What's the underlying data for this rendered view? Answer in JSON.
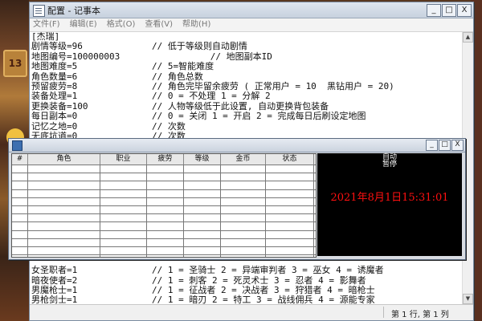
{
  "background": {
    "sign_text": "13"
  },
  "notepad": {
    "title": "配置 - 记事本",
    "caption_buttons": [
      "_",
      "□",
      "X"
    ],
    "menu": [
      "文件(F)",
      "编辑(E)",
      "格式(O)",
      "查看(V)",
      "帮助(H)"
    ],
    "lines_top": [
      "[杰瑞]",
      "剧情等级=96             // 低于等级则自动剧情",
      "地图编号=100000003                 // 地图副本ID",
      "地图难度=5              // 5=智能难度",
      "角色数量=6              // 角色总数",
      "预留疲劳=8              // 角色完毕留余疲劳 ( 正常用户 = 10  黑钻用户 = 20)",
      "装备处理=1              // 0 = 不处理 1 = 分解 2",
      "更换装备=100            // 人物等级低于此设置, 自动更换背包装备",
      "每日副本=0              // 0 = 关闭 1 = 开启 2 = 完成每日后刷设定地图",
      "记忆之地=0              // 次数",
      "无底坑道=0              // 次数"
    ],
    "lines_bottom": [
      "女圣职者=1              // 1 = 圣骑士 2 = 异端审判者 3 = 巫女 4 = 诱魔者",
      "暗夜使者=2              // 1 = 刺客 2 = 死灵术士 3 = 忍者 4 = 影舞者",
      "男魔枪士=1              // 1 = 征战者 2 = 决战者 3 = 狩猎者 4 = 暗枪士",
      "男枪剑士=1              // 1 = 暗刃 2 = 特工 3 = 战线佣兵 4 = 源能专家"
    ],
    "status_position": "第 1 行, 第 1 列"
  },
  "tool": {
    "caption_buttons": [
      "_",
      "□",
      "X"
    ],
    "columns": [
      "#",
      "角色",
      "职业",
      "疲劳",
      "等级",
      "金币",
      "状态"
    ],
    "row_count": 12,
    "auto_label": "自动",
    "pause_label": "暂停",
    "datetime": "2021年8月1日15:31:01",
    "datetime_color": "#ff1010"
  }
}
